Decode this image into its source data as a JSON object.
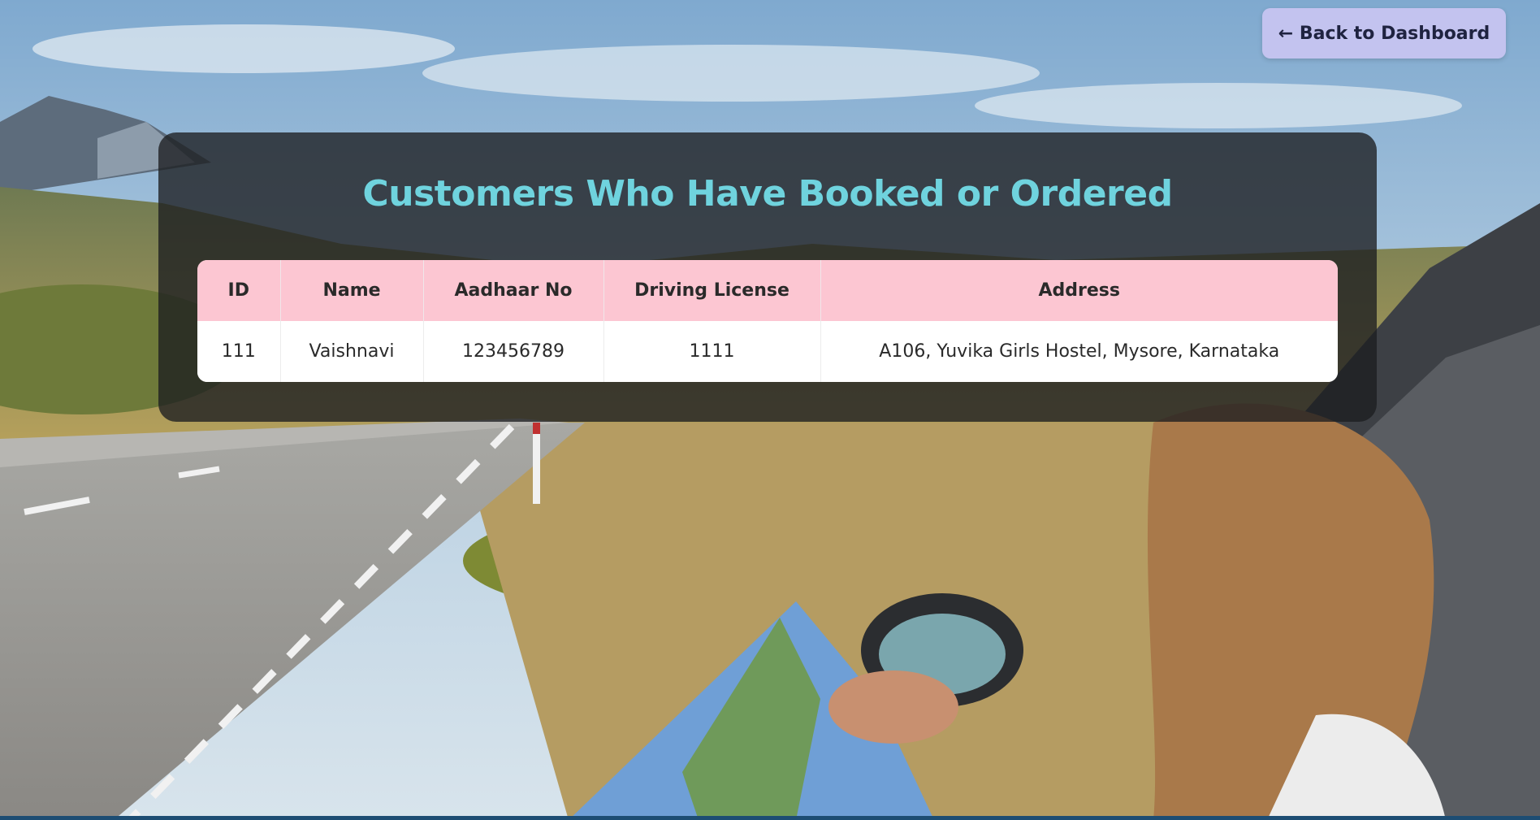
{
  "header": {
    "back_button_label": "← Back to Dashboard"
  },
  "main": {
    "title": "Customers Who Have Booked or Ordered",
    "table": {
      "columns": [
        "ID",
        "Name",
        "Aadhaar No",
        "Driving License",
        "Address"
      ],
      "rows": [
        [
          "111",
          "Vaishnavi",
          "123456789",
          "1111",
          "A106, Yuvika Girls Hostel, Mysore, Karnataka"
        ]
      ]
    }
  },
  "colors": {
    "title": "#6fd3de",
    "table_header_bg": "#fcc6d2",
    "back_button_bg": "#c3c3ef",
    "panel_bg": "rgba(28,30,32,0.78)"
  }
}
